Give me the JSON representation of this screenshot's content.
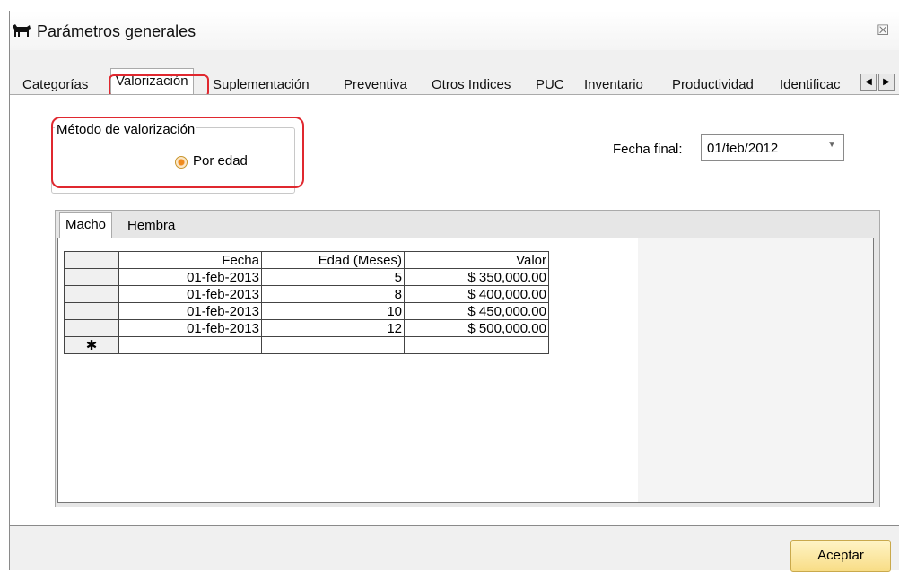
{
  "window": {
    "title": "Parámetros generales",
    "close_glyph": "☒"
  },
  "tabs": [
    {
      "label": "Categorías"
    },
    {
      "label": "Valorización",
      "active": true
    },
    {
      "label": "Suplementación"
    },
    {
      "label": "Preventiva"
    },
    {
      "label": "Otros Indices"
    },
    {
      "label": "PUC"
    },
    {
      "label": "Inventario"
    },
    {
      "label": "Productividad"
    },
    {
      "label": "Identificac"
    }
  ],
  "metodo": {
    "legend": "Método de valorización",
    "radio_label": "Por edad",
    "selected": true
  },
  "fecha_final": {
    "label": "Fecha final:",
    "value": "01/feb/2012"
  },
  "subtabs": [
    {
      "label": "Macho"
    },
    {
      "label": "Hembra"
    }
  ],
  "grid": {
    "columns": [
      "Fecha",
      "Edad (Meses)",
      "Valor"
    ],
    "rows": [
      [
        "01-feb-2013",
        "5",
        "$ 350,000.00"
      ],
      [
        "01-feb-2013",
        "8",
        "$ 400,000.00"
      ],
      [
        "01-feb-2013",
        "10",
        "$ 450,000.00"
      ],
      [
        "01-feb-2013",
        "12",
        "$ 500,000.00"
      ]
    ],
    "new_row_marker": "✱"
  },
  "buttons": {
    "accept": "Aceptar"
  },
  "colors": {
    "highlight_ring": "#e0282f",
    "accept_bg": "#f8dd86"
  }
}
